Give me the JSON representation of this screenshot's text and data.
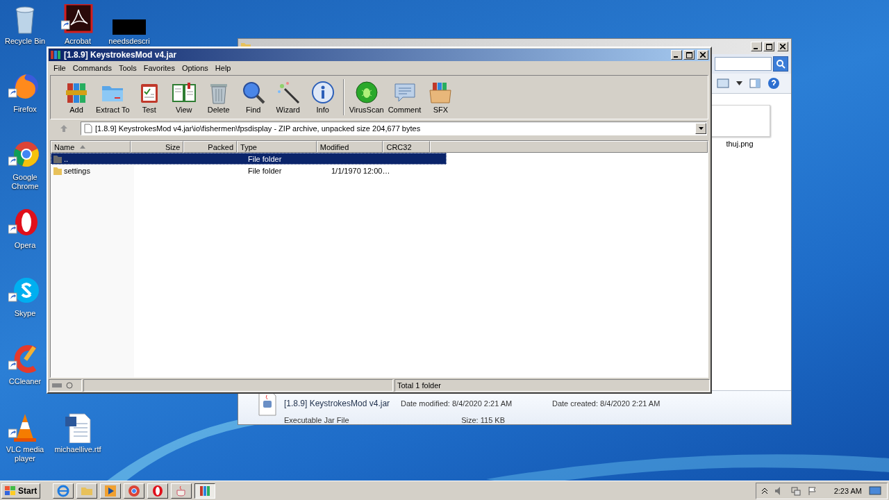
{
  "desktop_icons": [
    {
      "label": "Recycle Bin"
    },
    {
      "label": "Acrobat"
    },
    {
      "label": "needsdescri"
    },
    {
      "label": "Firefox"
    },
    {
      "label": "Google Chrome"
    },
    {
      "label": "Opera"
    },
    {
      "label": "Skype"
    },
    {
      "label": "CCleaner"
    },
    {
      "label": "VLC media player"
    },
    {
      "label": "michaellive.rtf"
    }
  ],
  "explorer": {
    "thumbnail_label": "thuj.png",
    "details": {
      "name": "[1.8.9] KeystrokesMod v4.jar",
      "type": "Executable Jar File",
      "modified": "Date modified: 8/4/2020 2:21 AM",
      "size": "Size: 115 KB",
      "created": "Date created: 8/4/2020 2:21 AM"
    }
  },
  "winrar": {
    "title": "[1.8.9] KeystrokesMod v4.jar",
    "menu": [
      "File",
      "Commands",
      "Tools",
      "Favorites",
      "Options",
      "Help"
    ],
    "toolbar": [
      {
        "label": "Add"
      },
      {
        "label": "Extract To"
      },
      {
        "label": "Test"
      },
      {
        "label": "View"
      },
      {
        "label": "Delete"
      },
      {
        "label": "Find"
      },
      {
        "label": "Wizard"
      },
      {
        "label": "Info"
      },
      {
        "label": "VirusScan"
      },
      {
        "label": "Comment"
      },
      {
        "label": "SFX"
      }
    ],
    "address": "[1.8.9] KeystrokesMod v4.jar\\io\\fishermen\\fpsdisplay - ZIP archive, unpacked size 204,677 bytes",
    "columns": [
      {
        "label": "Name",
        "sorted": true
      },
      {
        "label": "Size",
        "sorted": false
      },
      {
        "label": "Packed",
        "sorted": false
      },
      {
        "label": "Type",
        "sorted": false
      },
      {
        "label": "Modified",
        "sorted": false
      },
      {
        "label": "CRC32",
        "sorted": false
      }
    ],
    "rows": [
      {
        "name": "..",
        "type": "File folder",
        "selected": true
      },
      {
        "name": "settings",
        "type": "File folder",
        "modified": "1/1/1970 12:00…",
        "selected": false
      }
    ],
    "status": "Total 1 folder"
  },
  "taskbar": {
    "start": "Start",
    "items": [
      {
        "selected": false
      },
      {
        "selected": false
      },
      {
        "selected": false
      },
      {
        "selected": false
      },
      {
        "selected": false
      },
      {
        "selected": false
      },
      {
        "selected": true
      }
    ],
    "clock": "2:23 AM"
  }
}
